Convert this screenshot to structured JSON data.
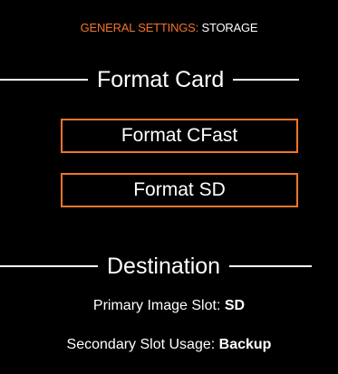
{
  "breadcrumb": {
    "section": "GENERAL SETTINGS:",
    "page": " STORAGE"
  },
  "format_card": {
    "heading": "Format Card",
    "cfast_button": "Format CFast",
    "sd_button": "Format SD"
  },
  "destination": {
    "heading": "Destination",
    "primary_label": "Primary Image Slot: ",
    "primary_value": "SD",
    "secondary_label": "Secondary Slot Usage: ",
    "secondary_value": "Backup"
  },
  "colors": {
    "accent": "#f0752a",
    "background": "#000000",
    "text": "#ffffff"
  }
}
